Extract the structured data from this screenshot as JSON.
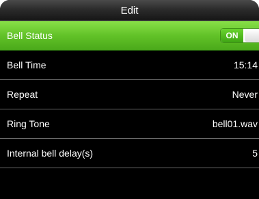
{
  "header": {
    "title": "Edit"
  },
  "settings": [
    {
      "label": "Bell Status",
      "toggle_label": "ON",
      "selected": true
    },
    {
      "label": "Bell Time",
      "value": "15:14"
    },
    {
      "label": "Repeat",
      "value": "Never"
    },
    {
      "label": "Ring Tone",
      "value": "bell01.wav"
    },
    {
      "label": "Internal bell delay(s)",
      "value": "5"
    }
  ],
  "colors": {
    "accent_green": "#62c228",
    "background": "#000000"
  }
}
